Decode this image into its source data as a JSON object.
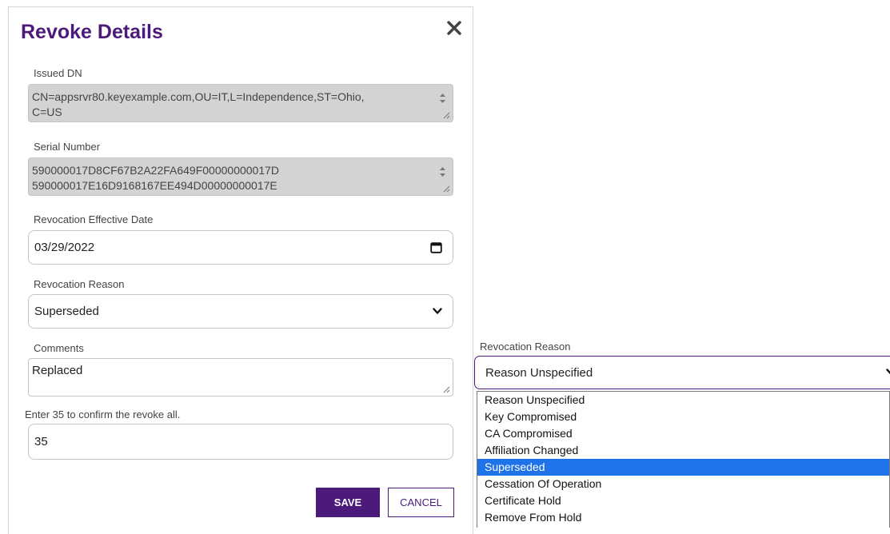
{
  "dialog": {
    "title": "Revoke Details",
    "issued_dn": {
      "label": "Issued DN",
      "value_line1": "CN=appsrvr80.keyexample.com,OU=IT,L=Independence,ST=Ohio,",
      "value_line2": "C=US"
    },
    "serial_number": {
      "label": "Serial Number",
      "value_line1": "590000017D8CF67B2A22FA649F00000000017D",
      "value_line2": "590000017E16D9168167EE494D00000000017E"
    },
    "effective_date": {
      "label": "Revocation Effective Date",
      "value": "03/29/2022"
    },
    "revocation_reason": {
      "label": "Revocation Reason",
      "value": "Superseded"
    },
    "comments": {
      "label": "Comments",
      "value": "Replaced"
    },
    "confirm": {
      "label": "Enter 35 to confirm the revoke all.",
      "value": "35"
    },
    "save_label": "SAVE",
    "cancel_label": "CANCEL"
  },
  "reason_dropdown": {
    "label": "Revocation Reason",
    "selected": "Reason Unspecified",
    "options": [
      "Reason Unspecified",
      "Key Compromised",
      "CA Compromised",
      "Affiliation Changed",
      "Superseded",
      "Cessation Of Operation",
      "Certificate Hold",
      "Remove From Hold"
    ],
    "highlighted": "Superseded"
  },
  "colors": {
    "accent": "#4b1a7a",
    "highlight": "#1e73e8",
    "readonly_bg": "#d3d3d3"
  },
  "icons": [
    "close-icon",
    "calendar-icon",
    "chevron-down-icon",
    "spinner-arrows-icon",
    "resize-grip-icon"
  ]
}
